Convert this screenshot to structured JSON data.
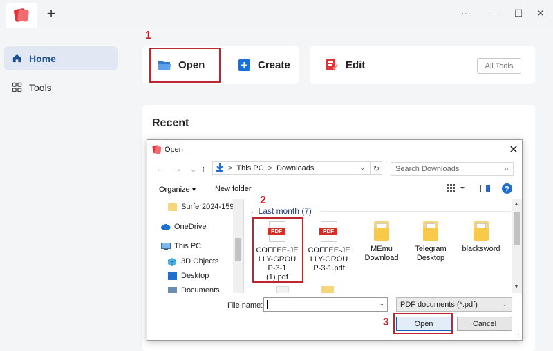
{
  "window": {
    "new_tab_symbol": "+",
    "more_symbol": "···",
    "minimize_symbol": "—",
    "maximize_symbol": "☐",
    "close_symbol": "✕"
  },
  "sidebar": {
    "items": [
      {
        "label": "Home",
        "active": true,
        "icon": "home-icon"
      },
      {
        "label": "Tools",
        "active": false,
        "icon": "grid-icon"
      }
    ]
  },
  "actions": {
    "open_label": "Open",
    "create_label": "Create",
    "edit_label": "Edit",
    "all_tools_label": "All Tools"
  },
  "recent": {
    "title": "Recent"
  },
  "steps": [
    "1",
    "2",
    "3"
  ],
  "dialog": {
    "title": "Open",
    "close_symbol": "✕",
    "nav_back": "←",
    "nav_forward": "→",
    "nav_dropdown": "⌄",
    "nav_up": "↑",
    "breadcrumb": [
      "This PC",
      "Downloads"
    ],
    "breadcrumb_sep": ">",
    "search_placeholder": "Search Downloads",
    "organize_label": "Organize ▾",
    "new_folder_label": "New folder",
    "tree": [
      "Surfer2024-159-",
      "OneDrive",
      "This PC",
      "3D Objects",
      "Desktop",
      "Documents"
    ],
    "group_header": "Last month (7)",
    "files": [
      {
        "name": "COFFEE-JELLY-GROUP-3-1 (1).pdf",
        "lines": [
          "COFFEE-JE",
          "LLY-GROU",
          "P-3-1",
          "(1).pdf"
        ],
        "type": "pdf"
      },
      {
        "name": "COFFEE-JELLY-GROUP-3-1.pdf",
        "lines": [
          "COFFEE-JE",
          "LLY-GROU",
          "P-3-1.pdf"
        ],
        "type": "pdf"
      },
      {
        "name": "MEmu Download",
        "lines": [
          "MEmu",
          "Download"
        ],
        "type": "folder"
      },
      {
        "name": "Telegram Desktop",
        "lines": [
          "Telegram",
          "Desktop"
        ],
        "type": "folder"
      },
      {
        "name": "blacksword",
        "lines": [
          "blacksword"
        ],
        "type": "folder"
      }
    ],
    "pdf_badge": "PDF",
    "file_name_label": "File name:",
    "file_name_value": "",
    "file_type_value": "PDF documents (*.pdf)",
    "open_button": "Open",
    "cancel_button": "Cancel"
  },
  "colors": {
    "accent": "#c0262d",
    "open_icon": "#3b86d6",
    "create_icon": "#1672d8",
    "edit_icon": "#e0333a"
  }
}
